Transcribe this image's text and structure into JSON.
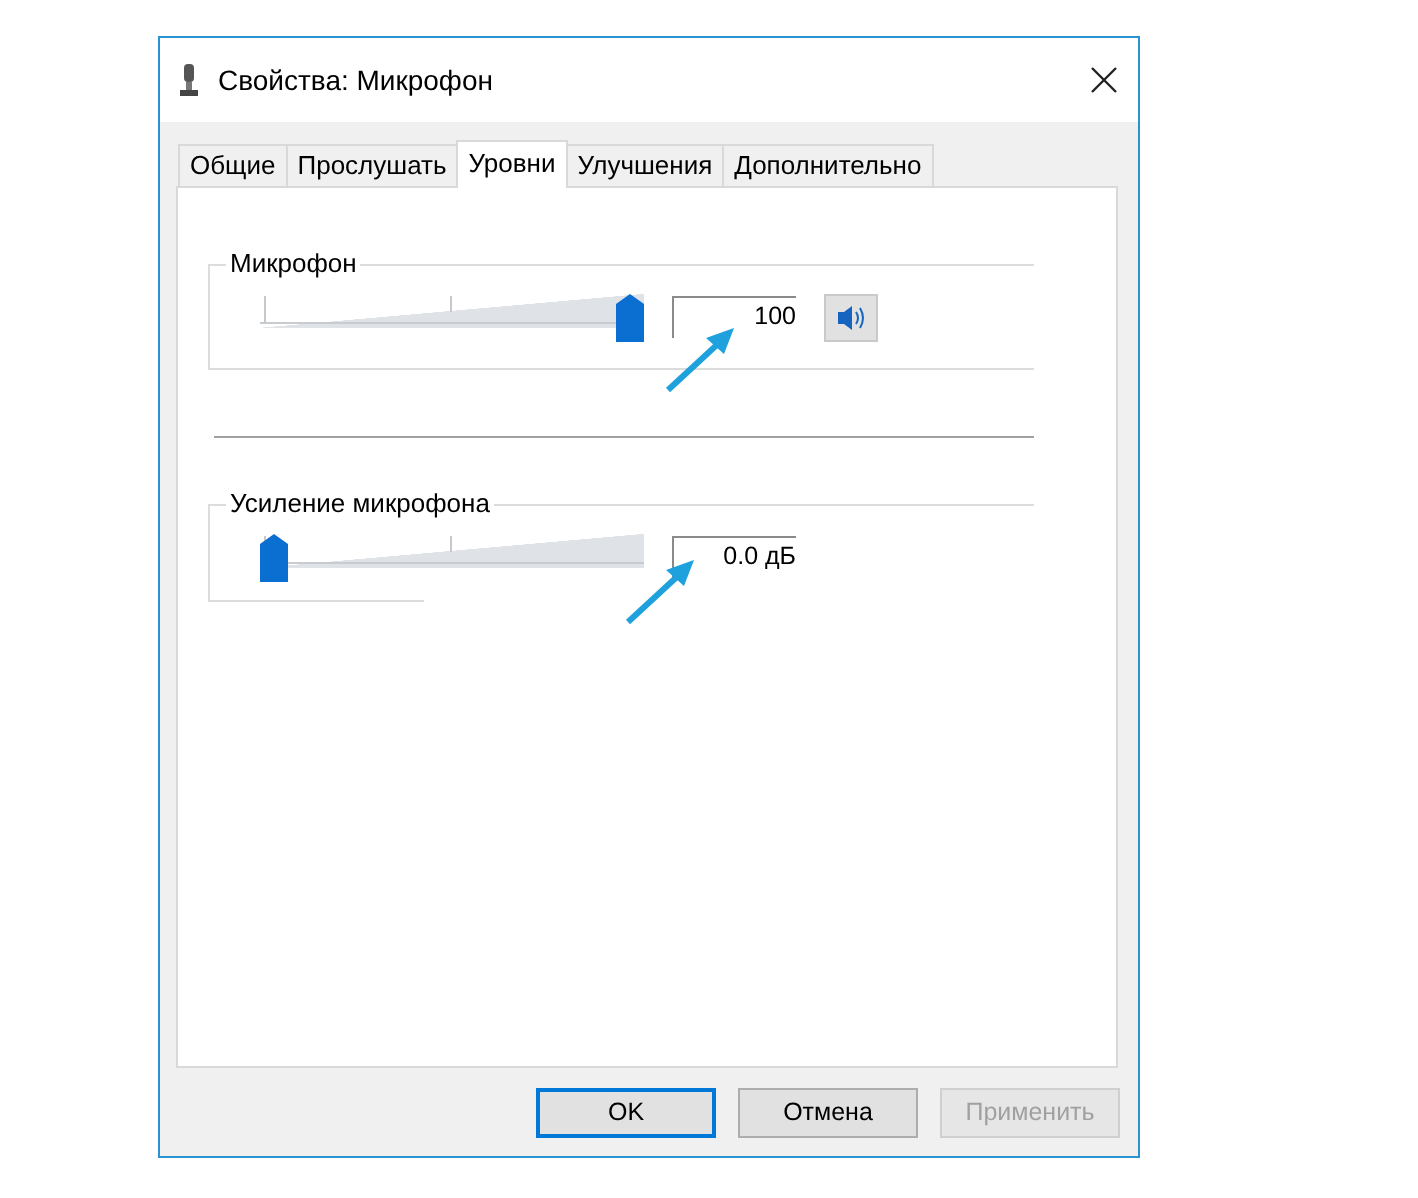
{
  "window": {
    "title": "Свойства: Микрофон"
  },
  "tabs": [
    {
      "label": "Общие",
      "selected": false
    },
    {
      "label": "Прослушать",
      "selected": false
    },
    {
      "label": "Уровни",
      "selected": true
    },
    {
      "label": "Улучшения",
      "selected": false
    },
    {
      "label": "Дополнительно",
      "selected": false
    }
  ],
  "levels": [
    {
      "kind": "volume",
      "label": "Микрофон",
      "level": 1,
      "value": "100",
      "muted": false
    },
    {
      "kind": "boost",
      "label": "Усиление микрофона",
      "level": 0,
      "value": "0.0 дБ"
    }
  ],
  "buttons": [
    {
      "label": "OK",
      "default": true,
      "disabled": false
    },
    {
      "label": "Отмена",
      "default": false,
      "disabled": false
    },
    {
      "label": "Применить",
      "default": false,
      "disabled": true
    }
  ]
}
